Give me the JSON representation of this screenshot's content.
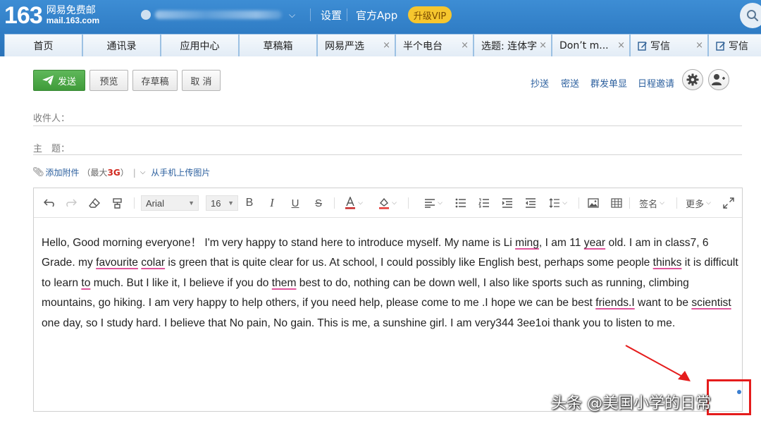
{
  "header": {
    "logo_number": "163",
    "logo_cn": "网易免费邮",
    "logo_url": "mail.163.com",
    "links": {
      "settings": "设置",
      "official_app": "官方App"
    },
    "vip_label": "升级VIP"
  },
  "tabs": [
    {
      "label": "首页"
    },
    {
      "label": "通讯录"
    },
    {
      "label": "应用中心"
    },
    {
      "label": "草稿箱"
    },
    {
      "label": "网易严选",
      "close": "×"
    },
    {
      "label": "半个电台",
      "close": "×"
    },
    {
      "label": "选题: 连体字",
      "close": "×"
    },
    {
      "label": "Don’t m...",
      "close": "×"
    },
    {
      "label": "写信",
      "close": "×"
    },
    {
      "label": "写信"
    }
  ],
  "compose": {
    "buttons": {
      "send": "发送",
      "preview": "预览",
      "save_draft": "存草稿",
      "cancel": "取 消"
    },
    "links": {
      "cc": "抄送",
      "bcc": "密送",
      "individual": "群发单显",
      "schedule": "日程邀请"
    },
    "to_label": "收件人：",
    "subject_label": "主　题：",
    "attach_label": "添加附件",
    "attach_note_prefix": "（最大",
    "attach_size": "3G",
    "attach_note_suffix": "）",
    "attach_sep": "|",
    "upload_phone": "从手机上传图片"
  },
  "editor": {
    "font": "Arial",
    "size": "16",
    "signature": "签名",
    "more": "更多",
    "body_segments": [
      "Hello, Good morning everyone！  I'm very happy to stand here to introduce myself. My name is Li ",
      "ming",
      ", I am 11 ",
      "year",
      " old. I am in class7, 6 Grade. my ",
      "favourite",
      " ",
      "colar",
      " is green that is quite clear for us. At school, I could possibly like English best, perhaps some people ",
      "thinks",
      " it is difficult to learn ",
      "to",
      " much. But I like it, I believe if you do ",
      "them",
      " best to do, nothing can be down well, I also like sports such as running, climbing mountains, go hiking. I am very happy to help others, if you need help, please come to me  .I  hope we can be best ",
      "friends.I",
      " want to be ",
      "scientist",
      " one day, so I study hard. I believe that No pain, No gain. This is me, a sunshine girl. I am very344 3ee1oi thank you to listen to me."
    ]
  },
  "watermark": "头条 @美国小学的日常",
  "colors": {
    "header": "#2f7cc4",
    "send_green": "#4aa444",
    "vip_yellow": "#f6c62e",
    "link_blue": "#2b5f9e",
    "annotation_red": "#e51c1c",
    "spell_underline": "#e0559b"
  }
}
